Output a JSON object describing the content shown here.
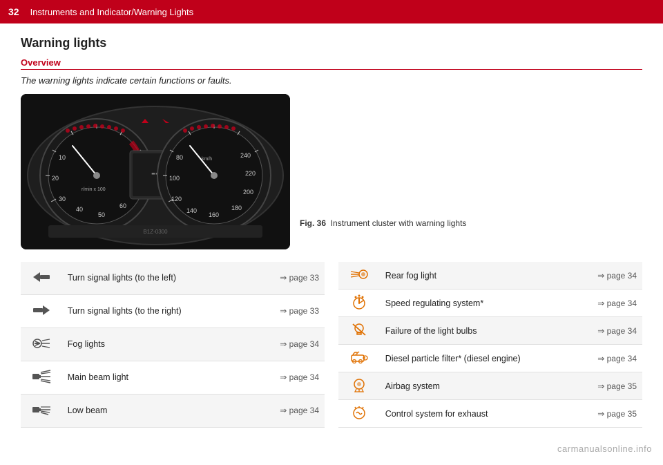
{
  "header": {
    "page_number": "32",
    "title": "Instruments and Indicator/Warning Lights"
  },
  "section": {
    "title": "Warning lights",
    "overview_heading": "Overview",
    "overview_text": "The warning lights indicate certain functions or faults.",
    "figure_label": "Fig. 36",
    "figure_caption": "Instrument cluster with warning lights",
    "figure_code": "B1Z-0300"
  },
  "left_table": {
    "rows": [
      {
        "icon": "turn-left",
        "label": "Turn signal lights (to the left)",
        "page": "⇒ page 33"
      },
      {
        "icon": "turn-right",
        "label": "Turn signal lights (to the right)",
        "page": "⇒ page 33"
      },
      {
        "icon": "fog",
        "label": "Fog lights",
        "page": "⇒ page 34"
      },
      {
        "icon": "main-beam",
        "label": "Main beam light",
        "page": "⇒ page 34"
      },
      {
        "icon": "low-beam",
        "label": "Low beam",
        "page": "⇒ page 34"
      }
    ]
  },
  "right_table": {
    "rows": [
      {
        "icon": "rear-fog",
        "label": "Rear fog light",
        "page": "⇒ page 34"
      },
      {
        "icon": "speed-reg",
        "label": "Speed regulating system*",
        "page": "⇒ page 34"
      },
      {
        "icon": "bulb-fail",
        "label": "Failure of the light bulbs",
        "page": "⇒ page 34"
      },
      {
        "icon": "diesel-filter",
        "label": "Diesel particle filter* (diesel engine)",
        "page": "⇒ page 34"
      },
      {
        "icon": "airbag",
        "label": "Airbag system",
        "page": "⇒ page 35"
      },
      {
        "icon": "exhaust",
        "label": "Control system for exhaust",
        "page": "⇒ page 35"
      }
    ]
  },
  "watermark": "carmanualsonline.info"
}
